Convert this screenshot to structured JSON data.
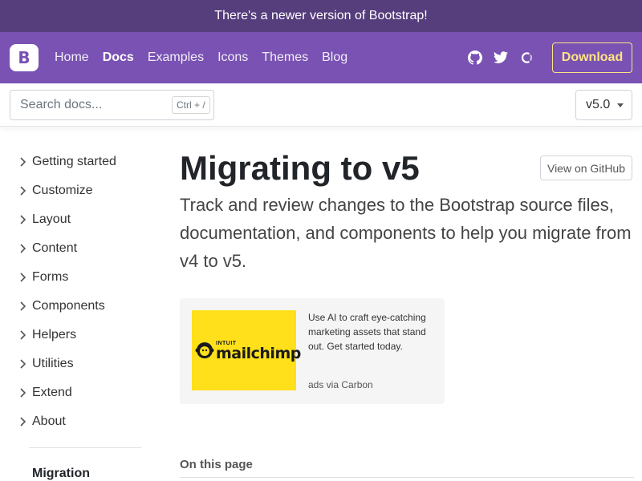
{
  "banner": {
    "text": "There's a newer version of Bootstrap!"
  },
  "navbar": {
    "logo_letter": "B",
    "links": [
      "Home",
      "Docs",
      "Examples",
      "Icons",
      "Themes",
      "Blog"
    ],
    "icons": [
      "github-icon",
      "twitter-icon",
      "opencollective-icon"
    ],
    "download_label": "Download"
  },
  "subheader": {
    "search_placeholder": "Search docs...",
    "shortcut": "Ctrl + /",
    "version": "v5.0"
  },
  "sidebar": {
    "items": [
      "Getting started",
      "Customize",
      "Layout",
      "Content",
      "Forms",
      "Components",
      "Helpers",
      "Utilities",
      "Extend",
      "About"
    ],
    "migration": "Migration"
  },
  "main": {
    "title": "Migrating to v5",
    "view_github": "View on GitHub",
    "lead": "Track and review changes to the Bootstrap source files, documentation, and components to help you migrate from v4 to v5.",
    "ad": {
      "brand_small": "INTUIT",
      "brand": "mailchimp",
      "text": "Use AI to craft eye-catching marketing assets that stand out. Get started today.",
      "via": "ads via Carbon"
    },
    "on_this_page": "On this page"
  },
  "colors": {
    "banner_bg": "#563d7c",
    "navbar_bg": "#7952b3",
    "download_accent": "#ffe484",
    "ad_bg": "#ffe01b"
  }
}
